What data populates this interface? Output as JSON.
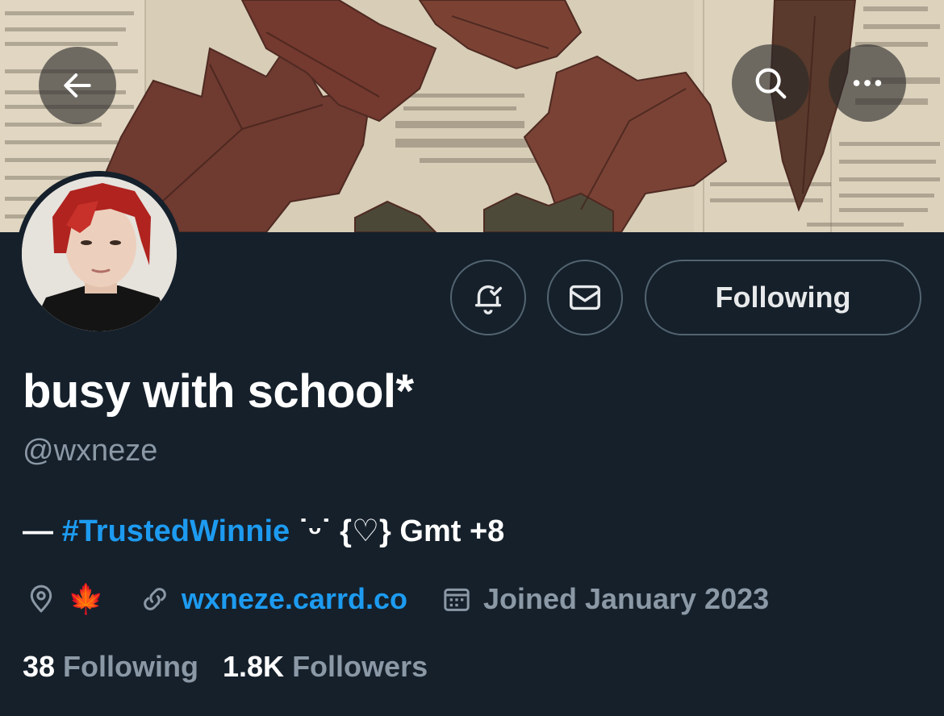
{
  "profile": {
    "display_name": "busy with school*",
    "handle": "@wxneze",
    "bio": {
      "dash": "— ",
      "hashtag": "#TrustedWinnie",
      "rest": " ˙ᵕ˙ {♡} Gmt +8"
    },
    "location_emoji": "🍁",
    "website": "wxneze.carrd.co",
    "joined": "Joined January 2023",
    "following_count": "38",
    "following_label": " Following",
    "followers_count": "1.8K",
    "followers_label": " Followers"
  },
  "actions": {
    "follow_state_label": "Following"
  },
  "icons": {
    "back": "arrow-left-icon",
    "search": "search-icon",
    "more": "more-horizontal-icon",
    "notify": "bell-check-icon",
    "message": "envelope-icon",
    "location": "location-pin-icon",
    "link": "link-icon",
    "calendar": "calendar-icon"
  },
  "colors": {
    "background": "#15202b",
    "accent": "#1d9bf0",
    "secondary_text": "#8b98a5",
    "border": "#536471"
  }
}
